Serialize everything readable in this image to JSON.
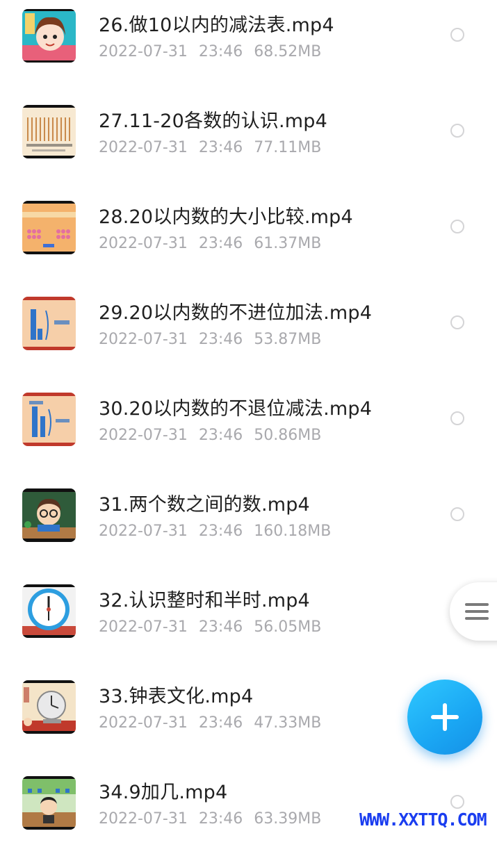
{
  "files": [
    {
      "name": "26.做10以内的减法表.mp4",
      "date": "2022-07-31",
      "time": "23:46",
      "size": "68.52MB",
      "thumb": "cartoon-girl-thumbnail"
    },
    {
      "name": "27.11-20各数的认识.mp4",
      "date": "2022-07-31",
      "time": "23:46",
      "size": "77.11MB",
      "thumb": "counting-sticks-thumbnail"
    },
    {
      "name": "28.20以内数的大小比较.mp4",
      "date": "2022-07-31",
      "time": "23:46",
      "size": "61.37MB",
      "thumb": "number-line-thumbnail"
    },
    {
      "name": "29.20以内数的不进位加法.mp4",
      "date": "2022-07-31",
      "time": "23:46",
      "size": "53.87MB",
      "thumb": "addition-blocks-thumbnail"
    },
    {
      "name": "30.20以内数的不退位减法.mp4",
      "date": "2022-07-31",
      "time": "23:46",
      "size": "50.86MB",
      "thumb": "subtraction-blocks-thumbnail"
    },
    {
      "name": "31.两个数之间的数.mp4",
      "date": "2022-07-31",
      "time": "23:46",
      "size": "160.18MB",
      "thumb": "teacher-cartoon-thumbnail"
    },
    {
      "name": "32.认识整时和半时.mp4",
      "date": "2022-07-31",
      "time": "23:46",
      "size": "56.05MB",
      "thumb": "clock-thumbnail"
    },
    {
      "name": "33.钟表文化.mp4",
      "date": "2022-07-31",
      "time": "23:46",
      "size": "47.33MB",
      "thumb": "antique-clock-thumbnail"
    },
    {
      "name": "34.9加几.mp4",
      "date": "2022-07-31",
      "time": "23:46",
      "size": "63.39MB",
      "thumb": "classroom-thumbnail"
    }
  ],
  "fab_icon": "plus-icon",
  "side_handle_icon": "hamburger-icon",
  "watermark": "WWW.XXTTQ.COM",
  "colors": {
    "accent": "#1aa6f3",
    "meta_text": "#a9a9ad",
    "watermark": "#1a3df0"
  }
}
